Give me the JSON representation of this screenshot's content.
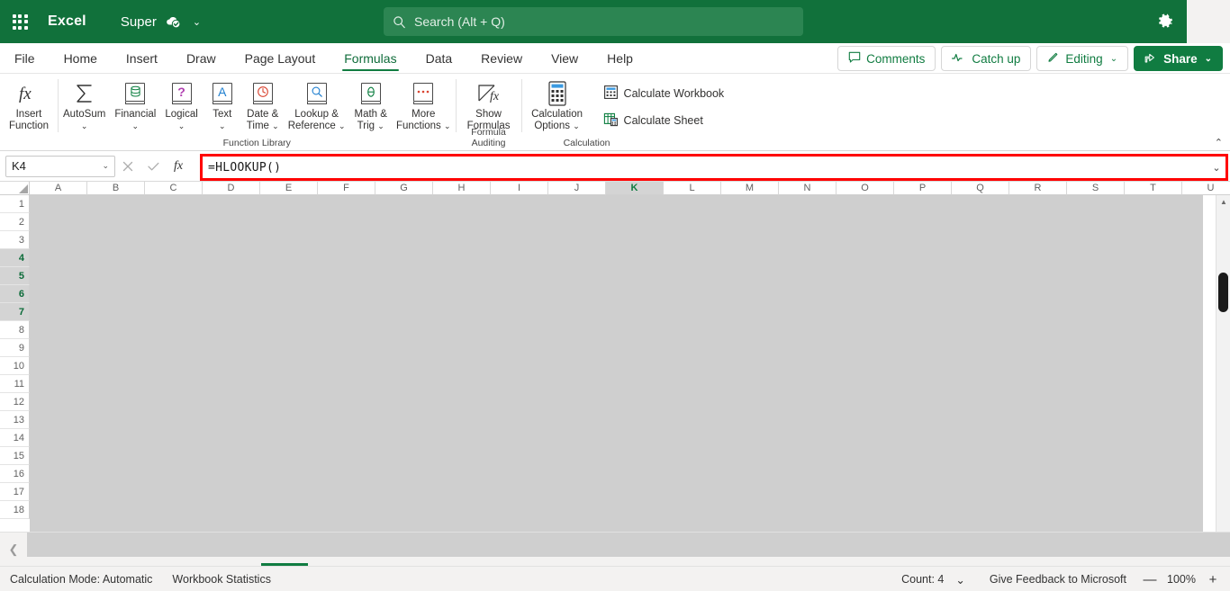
{
  "titlebar": {
    "waffle_icon": "app-launcher-icon",
    "app_name": "Excel",
    "doc_name": "Super",
    "saved_icon": "cloud-saved-icon",
    "doc_chevron": "⌄",
    "search": {
      "icon": "search-icon",
      "placeholder": "Search (Alt + Q)",
      "value": ""
    },
    "gear_icon": "gear-icon"
  },
  "tabs": [
    {
      "label": "File",
      "active": false
    },
    {
      "label": "Home",
      "active": false
    },
    {
      "label": "Insert",
      "active": false
    },
    {
      "label": "Draw",
      "active": false
    },
    {
      "label": "Page Layout",
      "active": false
    },
    {
      "label": "Formulas",
      "active": true
    },
    {
      "label": "Data",
      "active": false
    },
    {
      "label": "Review",
      "active": false
    },
    {
      "label": "View",
      "active": false
    },
    {
      "label": "Help",
      "active": false
    }
  ],
  "tab_actions": {
    "comments": {
      "label": "Comments",
      "icon": "comment-icon"
    },
    "catch_up": {
      "label": "Catch up",
      "icon": "activity-icon"
    },
    "editing": {
      "label": "Editing",
      "icon": "pencil-icon",
      "chevron": "⌄"
    },
    "share": {
      "label": "Share",
      "icon": "share-icon",
      "chevron": "⌄"
    }
  },
  "ribbon": {
    "collapse_icon": "chevron-up-icon",
    "groups": [
      {
        "name": "insert-function",
        "label": "",
        "buttons": [
          {
            "name": "insert-function",
            "label": "Insert\nFunction",
            "icon": "fx-icon",
            "chevron": false
          }
        ]
      },
      {
        "name": "function-library",
        "label": "Function Library",
        "buttons": [
          {
            "name": "autosum",
            "label": "AutoSum",
            "icon": "sigma-icon",
            "chevron": true
          },
          {
            "name": "financial",
            "label": "Financial",
            "icon": "financial-book-icon",
            "chevron": true
          },
          {
            "name": "logical",
            "label": "Logical",
            "icon": "logical-book-icon",
            "chevron": true
          },
          {
            "name": "text",
            "label": "Text",
            "icon": "text-book-icon",
            "chevron": true
          },
          {
            "name": "date-time",
            "label": "Date &\nTime",
            "icon": "clock-book-icon",
            "chevron": true
          },
          {
            "name": "lookup-reference",
            "label": "Lookup &\nReference",
            "icon": "lookup-book-icon",
            "chevron": true
          },
          {
            "name": "math-trig",
            "label": "Math &\nTrig",
            "icon": "theta-book-icon",
            "chevron": true
          },
          {
            "name": "more-functions",
            "label": "More\nFunctions",
            "icon": "more-book-icon",
            "chevron": true
          }
        ]
      },
      {
        "name": "formula-auditing",
        "label": "Formula Auditing",
        "buttons": [
          {
            "name": "show-formulas",
            "label": "Show\nFormulas",
            "icon": "show-formulas-icon",
            "chevron": false
          }
        ]
      },
      {
        "name": "calculation",
        "label": "Calculation",
        "buttons": [
          {
            "name": "calculation-options",
            "label": "Calculation\nOptions",
            "icon": "calculator-icon",
            "chevron": true
          }
        ],
        "small_buttons": [
          {
            "name": "calculate-workbook",
            "label": "Calculate Workbook",
            "icon": "calculate-workbook-icon"
          },
          {
            "name": "calculate-sheet",
            "label": "Calculate Sheet",
            "icon": "calculate-sheet-icon"
          }
        ]
      }
    ]
  },
  "formula_bar": {
    "name_box_value": "K4",
    "name_box_chevron": "⌄",
    "cancel_icon": "cancel-x-icon",
    "confirm_icon": "confirm-check-icon",
    "fx_icon": "fx-icon",
    "formula_value": "=HLOOKUP()",
    "expand_chevron": "⌄",
    "highlight_color": "#ff0000"
  },
  "grid": {
    "columns": [
      "A",
      "B",
      "C",
      "D",
      "E",
      "F",
      "G",
      "H",
      "I",
      "J",
      "K",
      "L",
      "M",
      "N",
      "O",
      "P",
      "Q",
      "R",
      "S",
      "T",
      "U"
    ],
    "selected_columns": [
      "K"
    ],
    "rows": [
      1,
      2,
      3,
      4,
      5,
      6,
      7,
      8,
      9,
      10,
      11,
      12,
      13,
      14,
      15,
      16,
      17,
      18
    ],
    "selected_rows": [
      4,
      5,
      6,
      7
    ],
    "scroll_up_icon": "scroll-up-arrow",
    "scroll_down_icon": "scroll-down-arrow"
  },
  "sheet_bar": {
    "nav_icon": "chevron-left-icon"
  },
  "status_bar": {
    "calculation_mode": "Calculation Mode: Automatic",
    "workbook_statistics": "Workbook Statistics",
    "count": "Count: 4",
    "count_chevron": "⌄",
    "feedback": "Give Feedback to Microsoft",
    "zoom_out_icon": "—",
    "zoom_level": "100%",
    "zoom_in_icon": "+"
  },
  "colors": {
    "brand_green": "#11713b",
    "accent_green": "#107c41",
    "search_green": "#2c8552",
    "highlight_red": "#ff0000",
    "grid_gray": "#cfcfcf"
  }
}
